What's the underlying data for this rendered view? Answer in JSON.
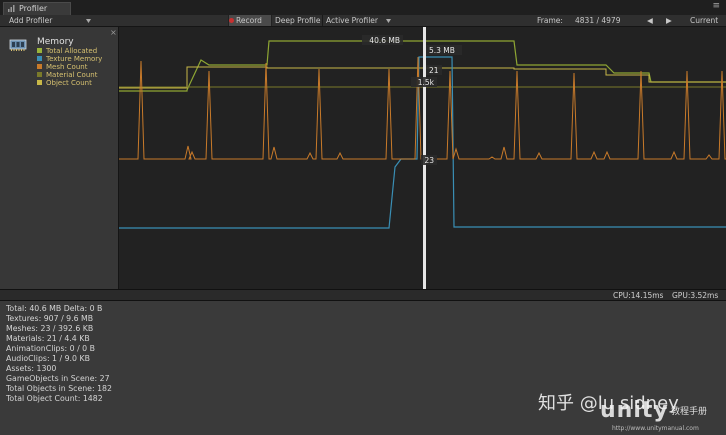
{
  "window": {
    "tab_label": "Profiler",
    "menu_glyph": "≡",
    "close_glyph": "×"
  },
  "toolbar": {
    "add_profiler": "Add Profiler",
    "record": "Record",
    "deep_profile": "Deep Profile",
    "active_profiler": "Active Profiler",
    "frame_label": "Frame:",
    "frame_value": "4831 / 4979",
    "prev_glyph": "◀",
    "next_glyph": "▶",
    "current": "Current"
  },
  "legend": {
    "title": "Memory",
    "items": [
      {
        "label": "Total Allocated",
        "color": "#9ab33a"
      },
      {
        "label": "Texture Memory",
        "color": "#3a8fb5"
      },
      {
        "label": "Mesh Count",
        "color": "#c87a2a"
      },
      {
        "label": "Material Count",
        "color": "#7a7a2a"
      },
      {
        "label": "Object Count",
        "color": "#c8b848"
      }
    ]
  },
  "chart_data": {
    "type": "line",
    "title": "Memory",
    "selected_frame_label": "4831 / 4979",
    "series": [
      {
        "name": "Total Allocated",
        "color": "#8ea633"
      },
      {
        "name": "Texture Memory",
        "color": "#3a8fb5"
      },
      {
        "name": "Mesh Count",
        "color": "#c87a2a"
      },
      {
        "name": "Material Count",
        "color": "#7a7a2a"
      },
      {
        "name": "Object Count",
        "color": "#c8b848"
      }
    ],
    "cursor_values": [
      {
        "series": "Total Allocated",
        "label": "40.6 MB"
      },
      {
        "series": "Texture Memory",
        "label": "5.3 MB"
      },
      {
        "series": "Material Count",
        "label": "21"
      },
      {
        "series": "Object Count",
        "label": "1.5k"
      },
      {
        "series": "Mesh Count",
        "label": "23"
      }
    ]
  },
  "status": {
    "cpu": "CPU:14.15ms",
    "gpu": "GPU:3.52ms"
  },
  "details": [
    "Total: 40.6 MB Delta: 0 B",
    "Textures: 907 / 9.6 MB",
    "Meshes: 23 / 392.6 KB",
    "Materials: 21 / 4.4 KB",
    "AnimationClips: 0 / 0 B",
    "AudioClips: 1 / 9.0 KB",
    "Assets: 1300",
    "GameObjects in Scene: 27",
    "Total Objects in Scene: 182",
    "Total Object Count: 1482"
  ],
  "watermark": {
    "site": "知乎 @lu sidney",
    "brand": "unity",
    "brand_cn": "教程手册",
    "url": "http://www.unitymanual.com"
  }
}
